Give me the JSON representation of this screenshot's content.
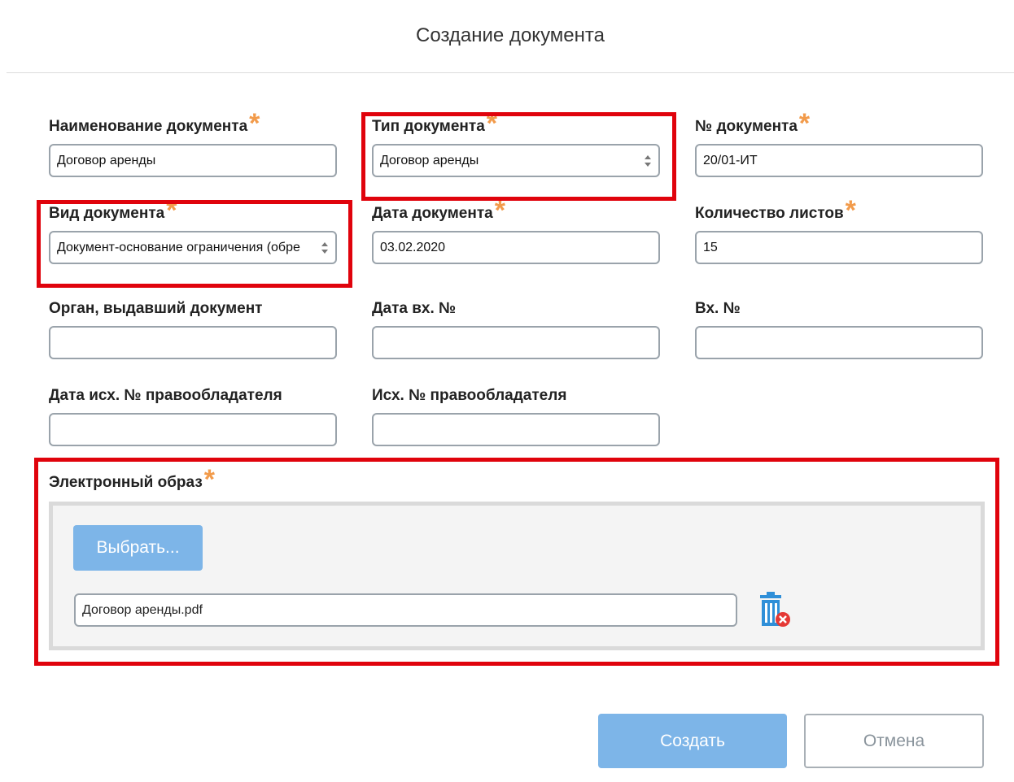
{
  "dialog": {
    "title": "Создание документа"
  },
  "form": {
    "doc_name": {
      "label": "Наименование документа",
      "value": "Договор аренды",
      "required": true
    },
    "doc_type": {
      "label": "Тип документа",
      "value": "Договор аренды",
      "required": true
    },
    "doc_number": {
      "label": "№ документа",
      "value": "20/01-ИТ",
      "required": true
    },
    "doc_kind": {
      "label": "Вид документа",
      "value": "Документ-основание ограничения (обре",
      "required": true
    },
    "doc_date": {
      "label": "Дата документа",
      "value": "03.02.2020",
      "required": true
    },
    "sheet_count": {
      "label": "Количество листов",
      "value": "15",
      "required": true
    },
    "issuer": {
      "label": "Орган, выдавший документ",
      "value": ""
    },
    "incoming_date": {
      "label": "Дата вх. №",
      "value": ""
    },
    "incoming_number": {
      "label": "Вх. №",
      "value": ""
    },
    "outgoing_date": {
      "label": "Дата исх. № правообладателя",
      "value": ""
    },
    "outgoing_number": {
      "label": "Исх. № правообладателя",
      "value": ""
    }
  },
  "electronic_image": {
    "label": "Электронный образ",
    "required": true,
    "choose_button": "Выбрать...",
    "file_name": "Договор аренды.pdf",
    "delete_icon": "trash-delete-icon"
  },
  "actions": {
    "create": "Создать",
    "cancel": "Отмена"
  },
  "colors": {
    "required_star": "#f29b4b",
    "highlight": "#e0030c",
    "primary_button": "#7db5e8"
  },
  "required_mark": "*"
}
